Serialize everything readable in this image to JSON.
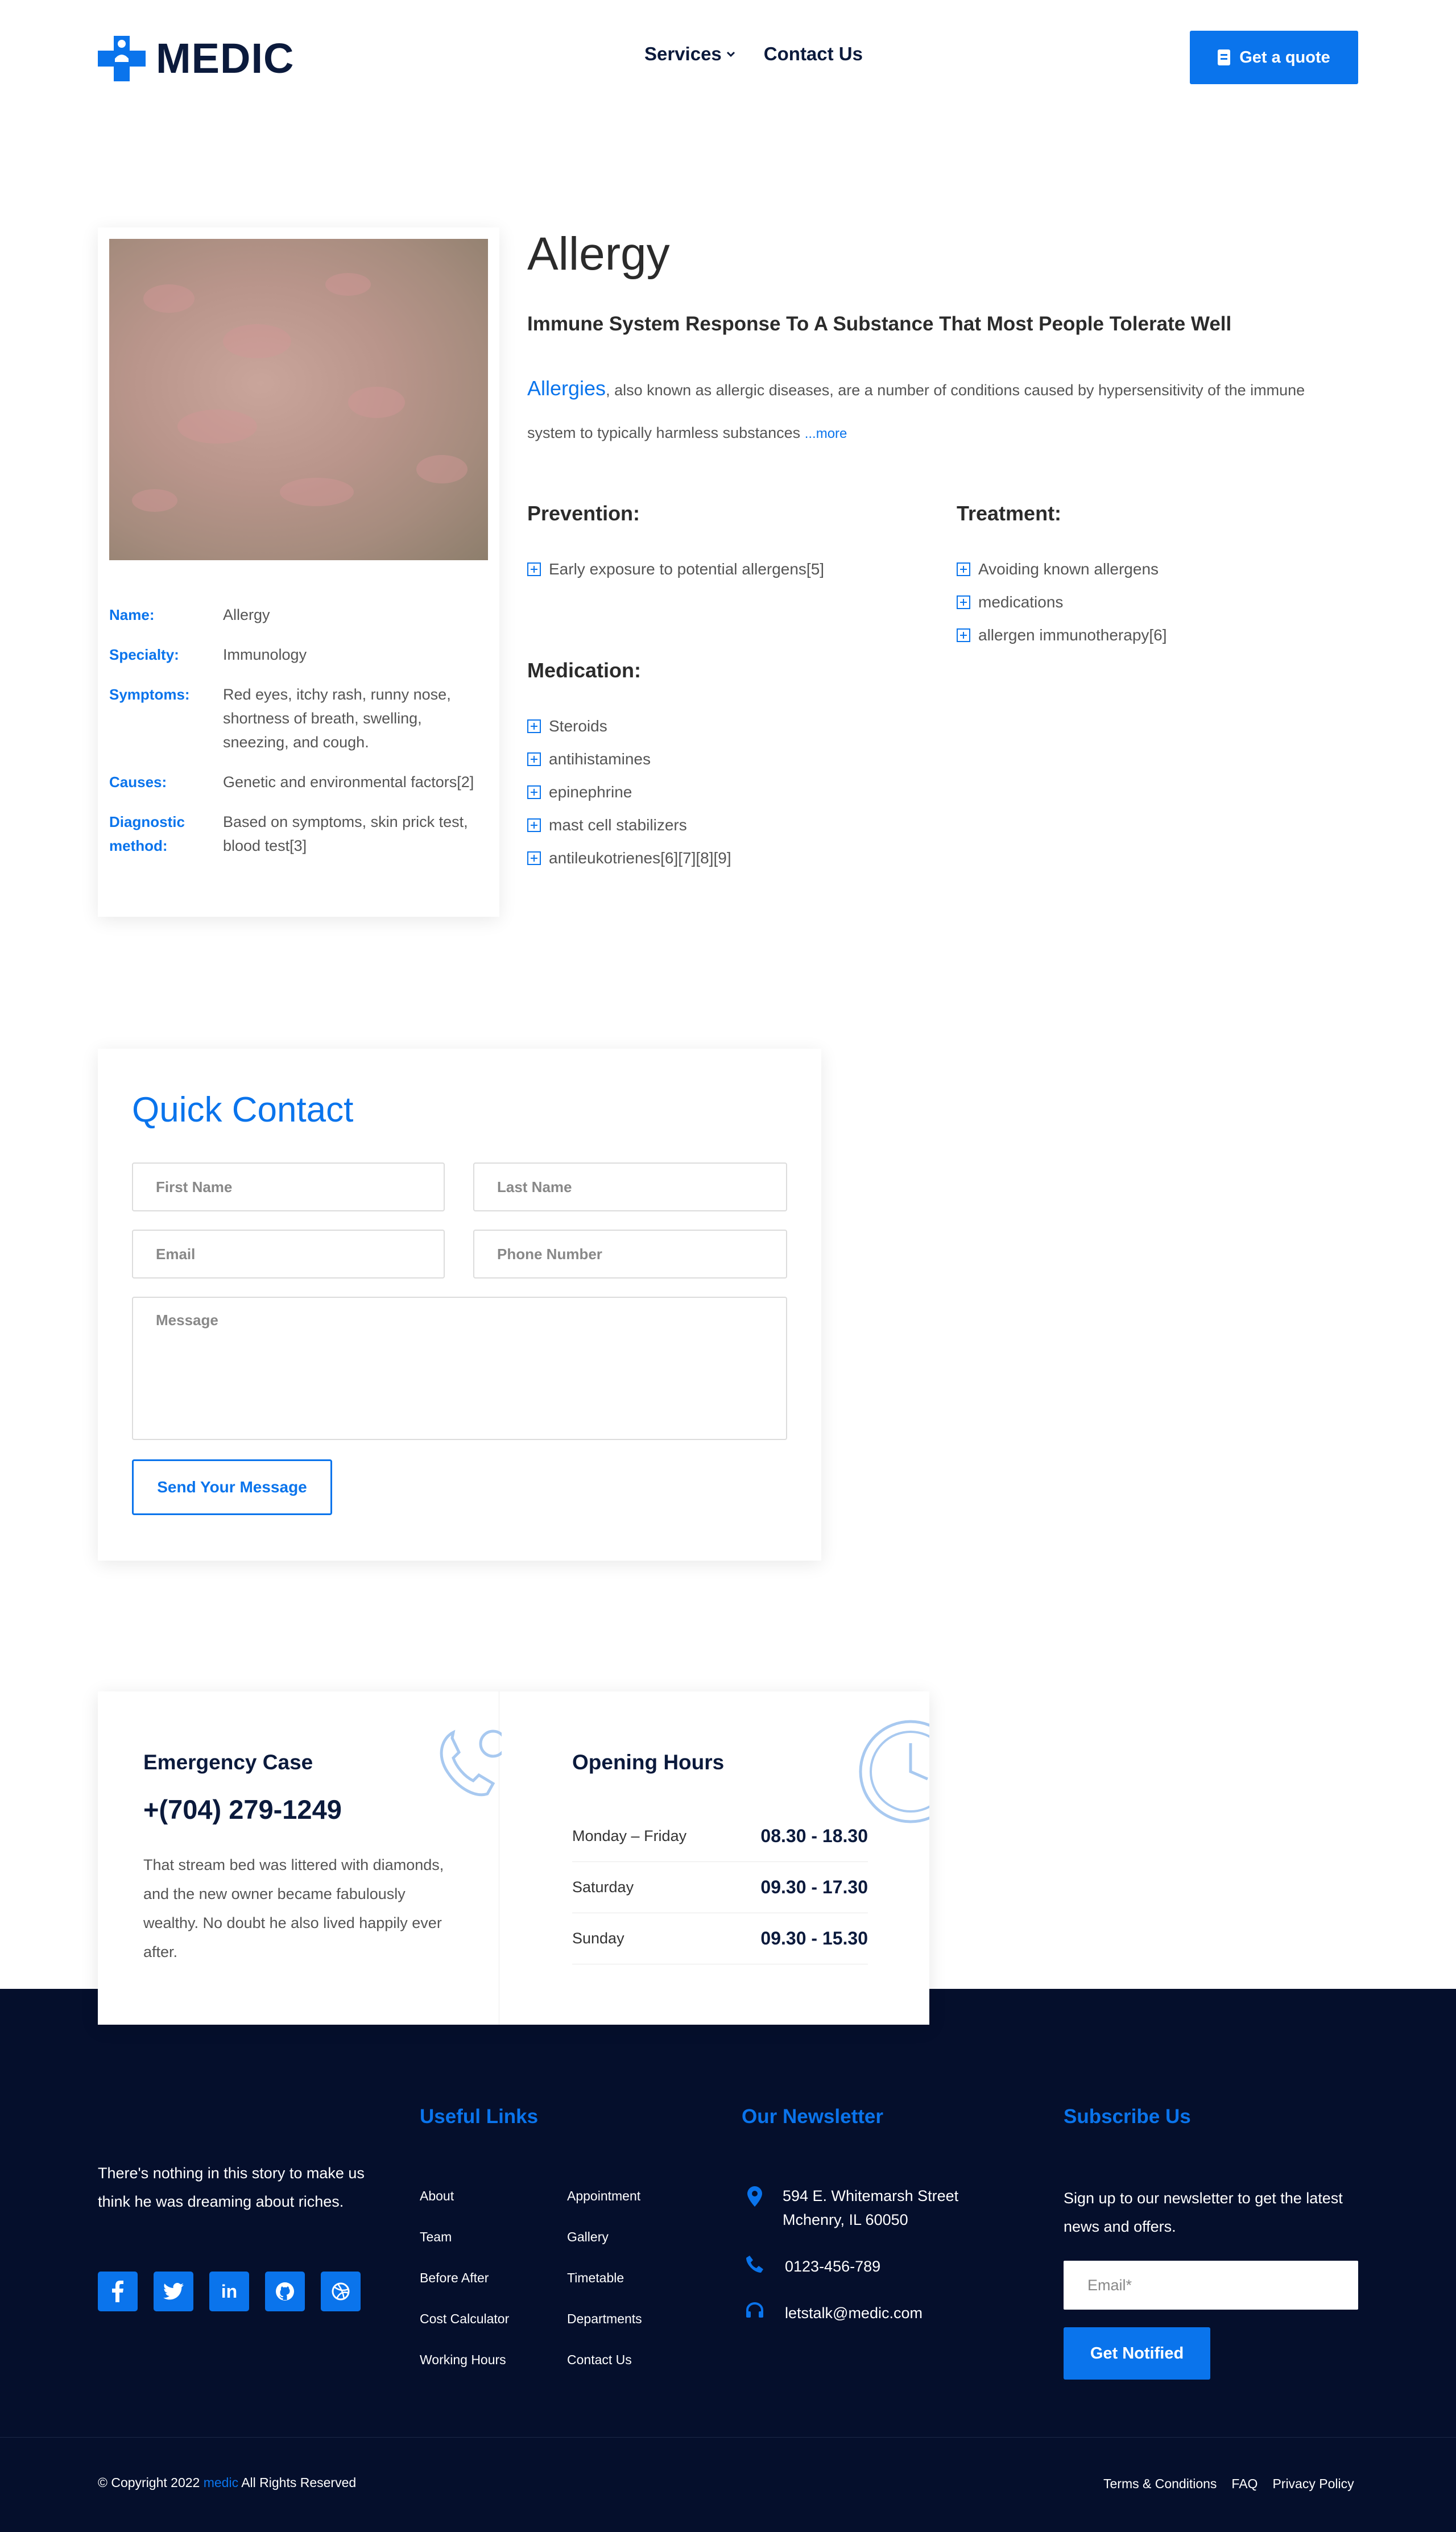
{
  "header": {
    "logo_text": "MEDIC",
    "nav": [
      {
        "label": "Services"
      },
      {
        "label": "Contact Us"
      }
    ],
    "quote_button": "Get a quote"
  },
  "disease": {
    "title": "Allergy",
    "subtitle": "Immune System Response To A Substance That Most People Tolerate Well",
    "description_lead": "Allergies",
    "description_text": ", also known as allergic diseases, are a number of conditions caused by hypersensitivity of the immune system to typically harmless substances",
    "more_link": "...more",
    "info": [
      {
        "key": "Name:",
        "value": "Allergy"
      },
      {
        "key": "Specialty:",
        "value": "Immunology"
      },
      {
        "key": "Symptoms:",
        "value": "Red eyes, itchy rash, runny nose, shortness of breath, swelling, sneezing, and cough."
      },
      {
        "key": "Causes:",
        "value": "Genetic and environmental factors[2]"
      },
      {
        "key": "Diagnostic method:",
        "value": "Based on symptoms, skin prick test, blood test[3]"
      }
    ],
    "prevention_title": "Prevention:",
    "prevention": [
      "Early exposure to potential allergens[5]"
    ],
    "treatment_title": "Treatment:",
    "treatment": [
      "Avoiding known allergens",
      "medications",
      "allergen immunotherapy[6]"
    ],
    "medication_title": "Medication:",
    "medication": [
      "Steroids",
      "antihistamines",
      "epinephrine",
      "mast cell stabilizers",
      "antileukotrienes[6][7][8][9]"
    ]
  },
  "quick_contact": {
    "title": "Quick Contact",
    "first_name": "First Name",
    "last_name": "Last Name",
    "email": "Email",
    "phone": "Phone Number",
    "message": "Message",
    "send_button": "Send Your Message"
  },
  "emergency": {
    "title": "Emergency Case",
    "phone": "+(704) 279-1249",
    "text": "That stream bed was littered with diamonds, and the new owner became fabulously wealthy. No doubt he also lived happily ever after."
  },
  "opening_hours": {
    "title": "Opening Hours",
    "rows": [
      {
        "day": "Monday – Friday",
        "time": "08.30 - 18.30"
      },
      {
        "day": "Saturday",
        "time": "09.30 - 17.30"
      },
      {
        "day": "Sunday",
        "time": "09.30 - 15.30"
      }
    ]
  },
  "footer": {
    "about_text": "There's nothing in this story to make us think he was dreaming about riches.",
    "useful_links_title": "Useful Links",
    "links_col1": [
      "About",
      "Team",
      "Before After",
      "Cost Calculator",
      "Working Hours"
    ],
    "links_col2": [
      "Appointment",
      "Gallery",
      "Timetable",
      "Departments",
      "Contact Us"
    ],
    "newsletter_title": "Our Newsletter",
    "address": "594 E. Whitemarsh Street Mchenry, IL 60050",
    "phone": "0123-456-789",
    "email": "letstalk@medic.com",
    "subscribe_title": "Subscribe Us",
    "subscribe_text": "Sign up to our newsletter to get the latest news and offers.",
    "email_placeholder": "Email*",
    "notify_button": "Get Notified",
    "copyright_pre": "© Copyright 2022",
    "copyright_brand": "medic",
    "copyright_post": "All Rights Reserved",
    "bottom_links": [
      "Terms & Conditions",
      "FAQ",
      "Privacy Policy"
    ]
  },
  "colors": {
    "accent": "#0a74ec",
    "navy": "#050f2c"
  }
}
